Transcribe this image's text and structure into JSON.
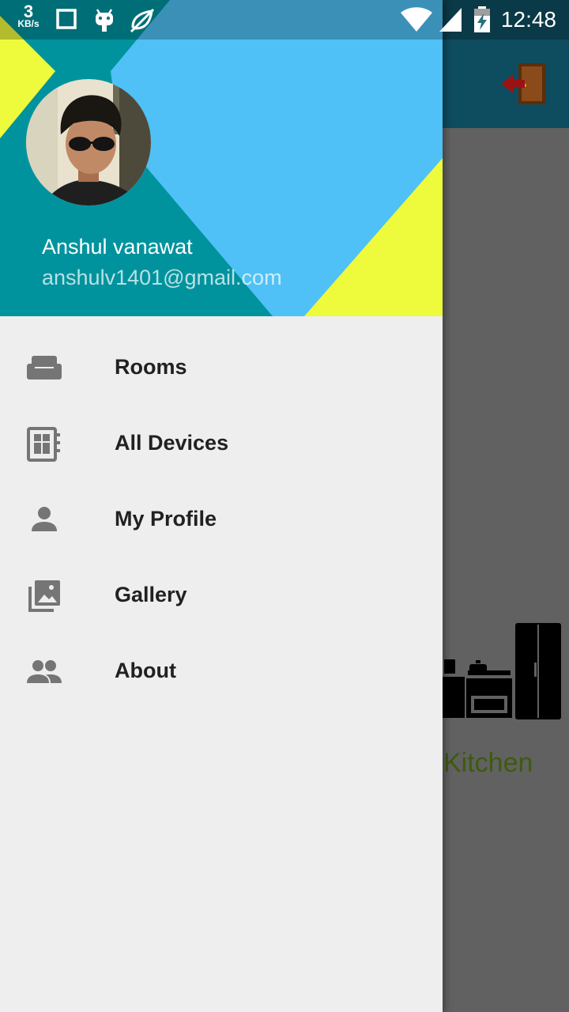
{
  "status_bar": {
    "speed_value": "3",
    "speed_unit": "KB/s",
    "time": "12:48"
  },
  "background_app": {
    "room_label": "Kitchen"
  },
  "drawer": {
    "header": {
      "user_name": "Anshul vanawat",
      "user_email": "anshulv1401@gmail.com"
    },
    "menu": [
      {
        "label": "Rooms",
        "icon": "sofa-icon"
      },
      {
        "label": "All Devices",
        "icon": "devices-icon"
      },
      {
        "label": "My Profile",
        "icon": "person-icon"
      },
      {
        "label": "Gallery",
        "icon": "gallery-icon"
      },
      {
        "label": "About",
        "icon": "people-icon"
      }
    ]
  },
  "colors": {
    "header_teal": "#00939e",
    "header_light_blue": "#4fc1f6",
    "header_yellow": "#eefb3c",
    "drawer_bg": "#eeeeee",
    "icon_grey": "#757575",
    "kitchen_label": "#3e5a10"
  }
}
